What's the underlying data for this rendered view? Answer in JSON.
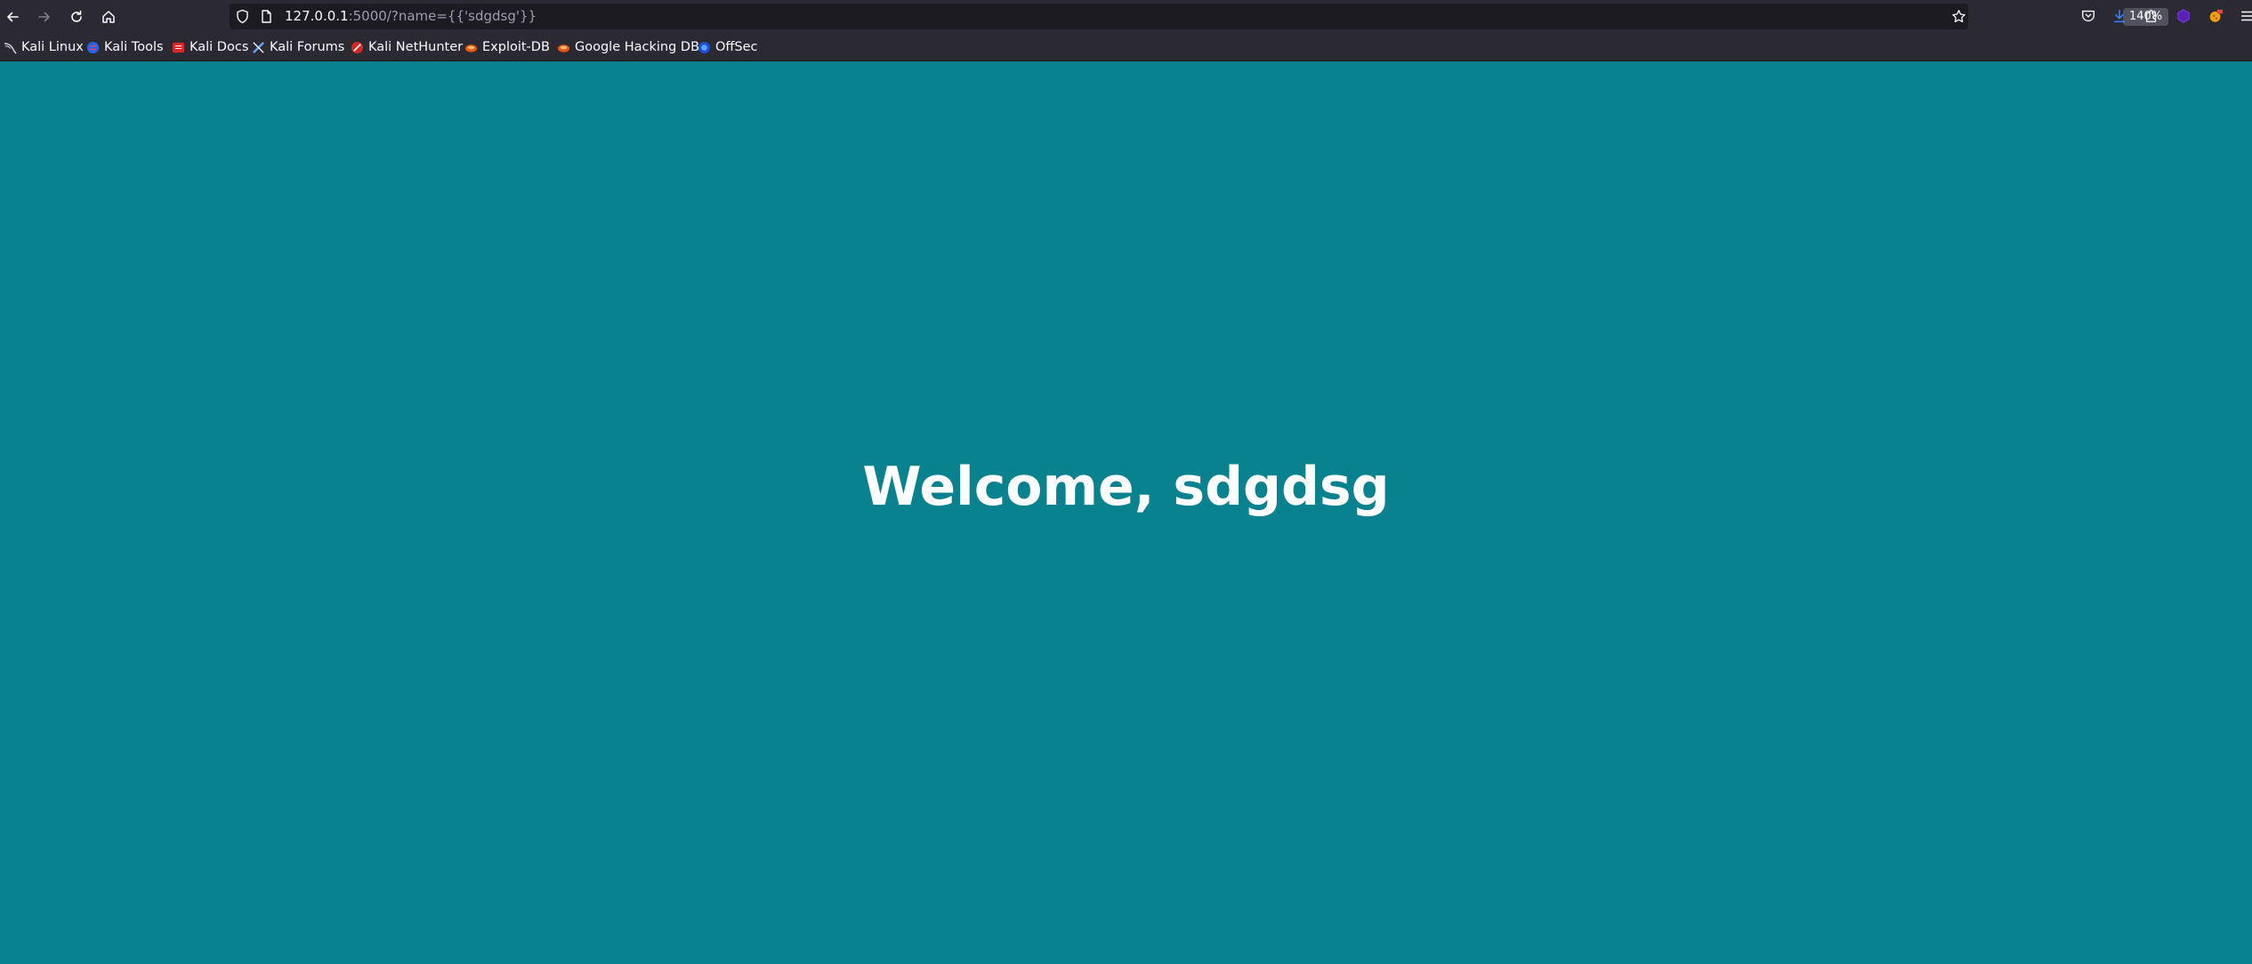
{
  "browser": {
    "url_host": "127.0.0.1",
    "url_rest": ":5000/?name={{'sdgdsg'}}",
    "zoom": "140%"
  },
  "bookmarks": [
    {
      "label": "Kali Linux",
      "icon": "kali-dragon-icon"
    },
    {
      "label": "Kali Tools",
      "icon": "kali-tools-icon"
    },
    {
      "label": "Kali Docs",
      "icon": "kali-docs-icon"
    },
    {
      "label": "Kali Forums",
      "icon": "kali-forums-icon"
    },
    {
      "label": "Kali NetHunter",
      "icon": "nethunter-icon"
    },
    {
      "label": "Exploit-DB",
      "icon": "exploit-db-icon"
    },
    {
      "label": "Google Hacking DB",
      "icon": "ghdb-icon"
    },
    {
      "label": "OffSec",
      "icon": "offsec-icon"
    }
  ],
  "page": {
    "greeting": "Welcome, sdgdsg",
    "background_color": "#08828e"
  }
}
